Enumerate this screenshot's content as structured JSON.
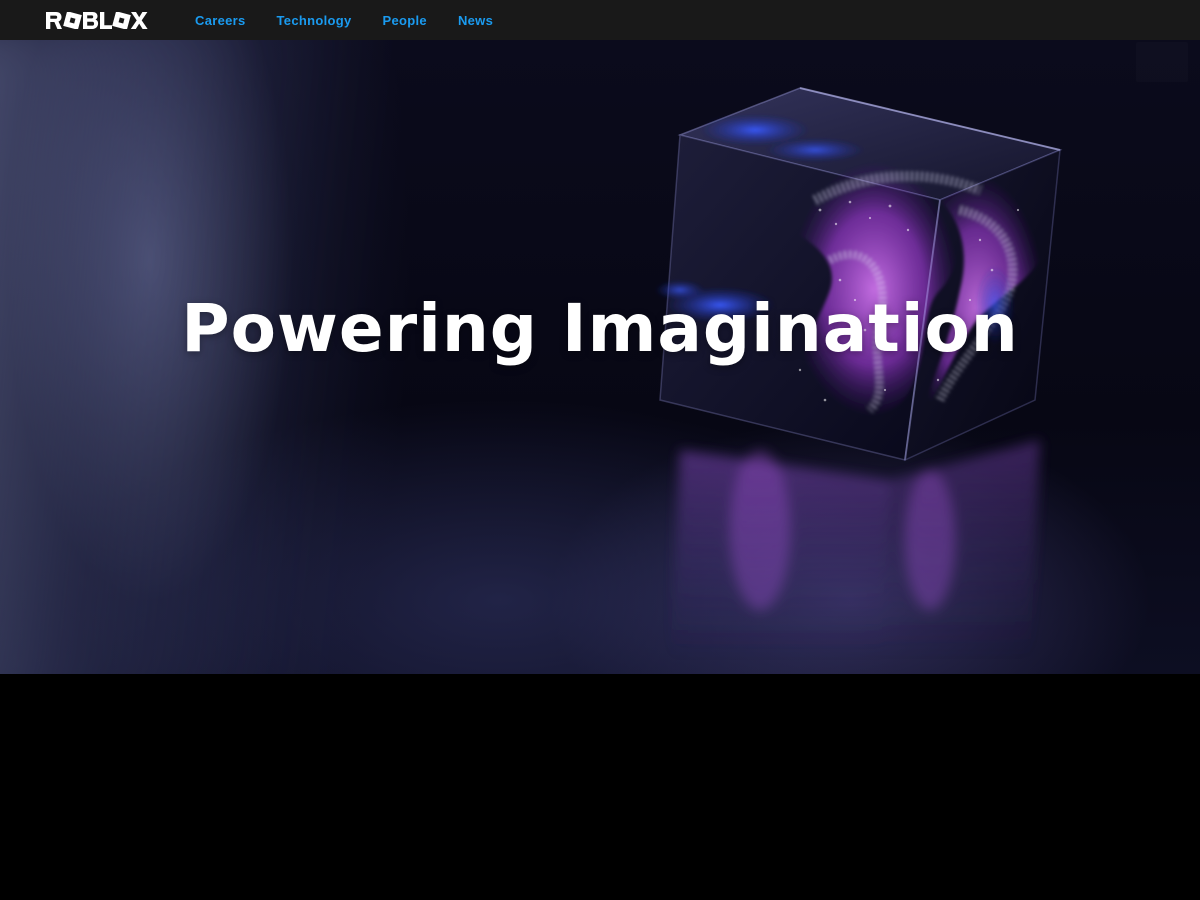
{
  "brand": {
    "logo_text": "ROBLOX",
    "logo_icon": "roblox-logo-icon",
    "nav_link_color": "#1a9bf0",
    "nav_background": "#191919"
  },
  "nav": {
    "items": [
      {
        "label": "Careers"
      },
      {
        "label": "Technology"
      },
      {
        "label": "People"
      },
      {
        "label": "News"
      }
    ]
  },
  "hero": {
    "title": "Powering Imagination",
    "image_icon": "glass-cube-particles-image",
    "title_color": "#ffffff"
  }
}
